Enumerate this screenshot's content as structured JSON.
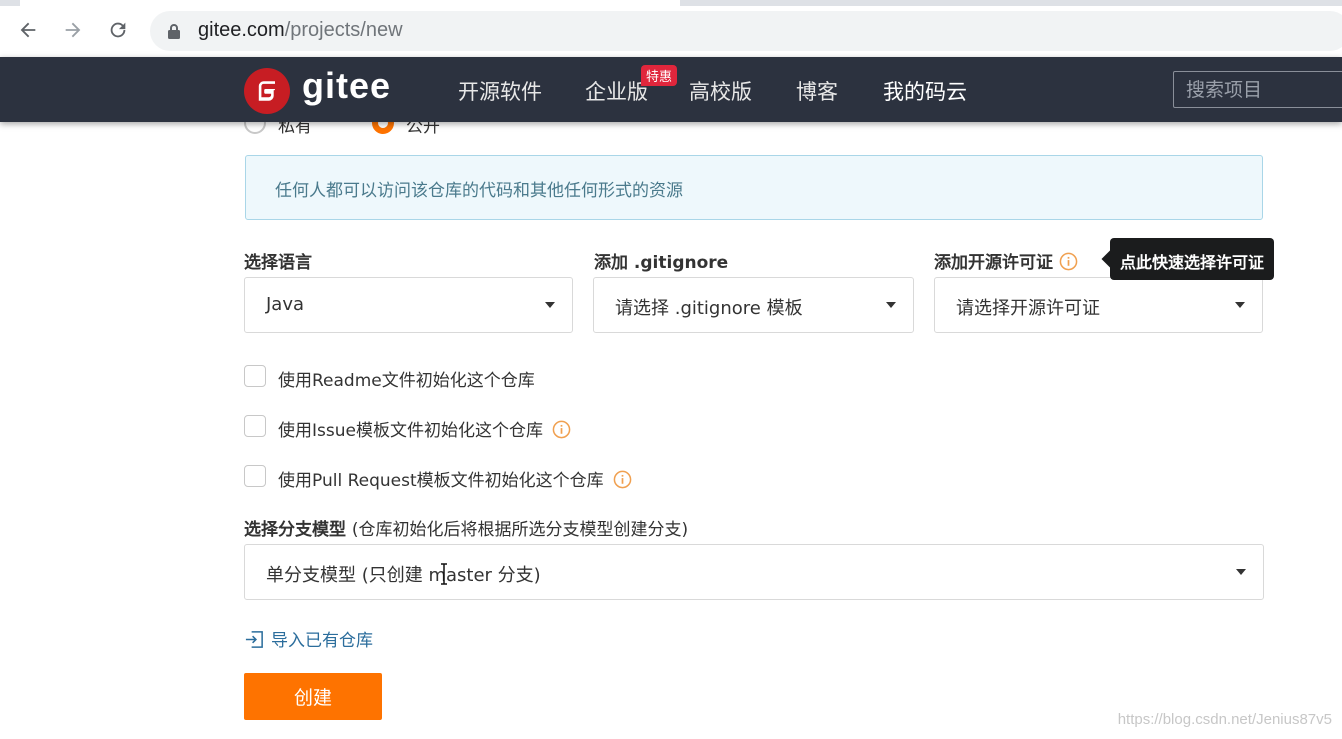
{
  "browser": {
    "url_host": "gitee.com",
    "url_path": "/projects/new"
  },
  "header": {
    "logo_text": "gitee",
    "nav": [
      "开源软件",
      "企业版",
      "高校版",
      "博客",
      "我的码云"
    ],
    "promo_badge": "特惠",
    "search_placeholder": "搜索项目"
  },
  "visibility": {
    "private_label": "私有",
    "public_label": "公开",
    "selected": "public",
    "info_text": "任何人都可以访问该仓库的代码和其他任何形式的资源"
  },
  "language": {
    "label": "选择语言",
    "value": "Java"
  },
  "gitignore": {
    "label": "添加 .gitignore",
    "value": "请选择 .gitignore 模板"
  },
  "license": {
    "label": "添加开源许可证",
    "value": "请选择开源许可证",
    "tooltip": "点此快速选择许可证"
  },
  "checkboxes": [
    {
      "label": "使用Readme文件初始化这个仓库",
      "checked": false,
      "info": false
    },
    {
      "label": "使用Issue模板文件初始化这个仓库",
      "checked": false,
      "info": true
    },
    {
      "label": "使用Pull Request模板文件初始化这个仓库",
      "checked": false,
      "info": true
    }
  ],
  "branch_model": {
    "label": "选择分支模型",
    "hint": "(仓库初始化后将根据所选分支模型创建分支)",
    "value": "单分支模型 (只创建 master 分支)"
  },
  "import_link": "导入已有仓库",
  "create_button": "创建",
  "watermark": "https://blog.csdn.net/Jenius87v5",
  "colors": {
    "accent": "#fe7300",
    "header_bg": "#2c323f",
    "logo_red": "#c71d23",
    "info_bg": "#eef8fc",
    "link": "#2b6d9c"
  }
}
